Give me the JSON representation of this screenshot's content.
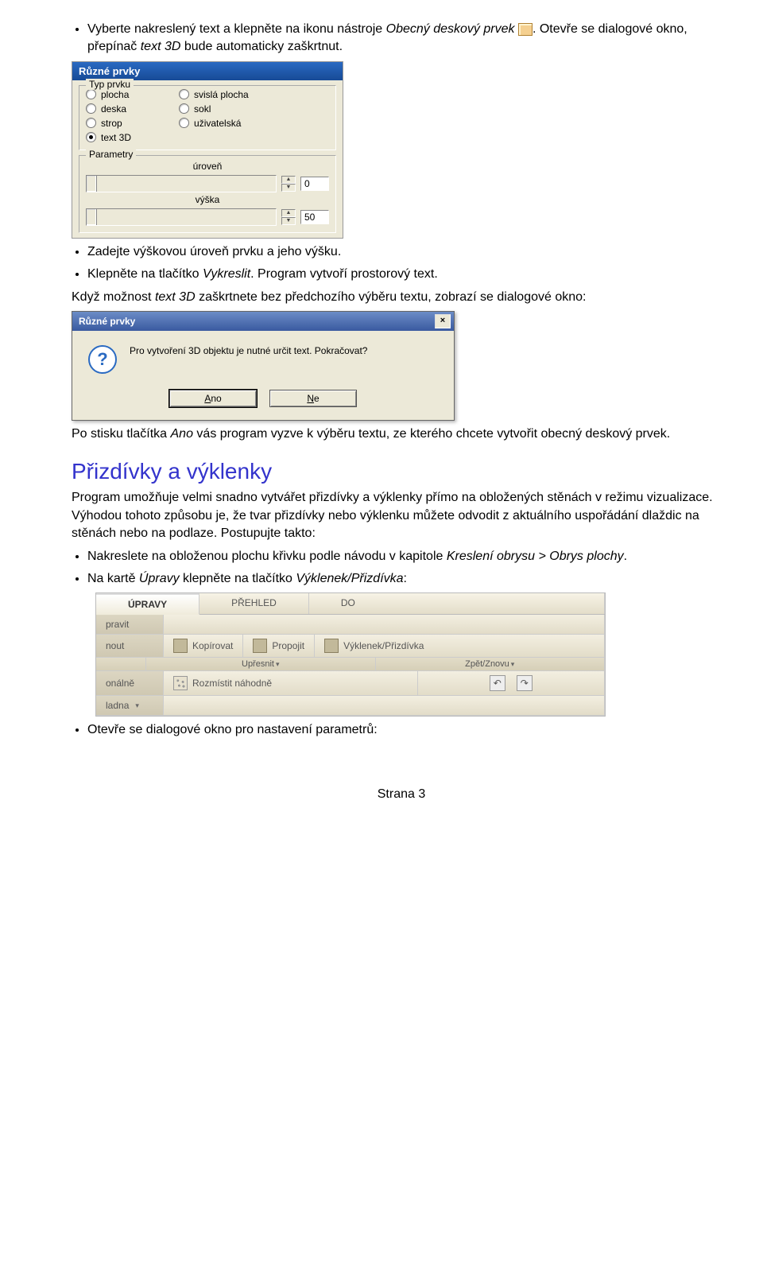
{
  "intro": {
    "li1_a": "Vyberte nakreslený text a klepněte na ikonu nástroje ",
    "li1_tool": "Obecný deskový prvek",
    "li1_b": ". Otevře se dialogové okno, přepínač ",
    "li1_switch": "text 3D",
    "li1_c": " bude automaticky zaškrtnut."
  },
  "dlg1": {
    "title": "Různé prvky",
    "group_type": "Typ prvku",
    "radios_left": [
      "plocha",
      "deska",
      "strop",
      "text 3D"
    ],
    "radios_right": [
      "svislá plocha",
      "sokl",
      "uživatelská"
    ],
    "selected": "text 3D",
    "group_params": "Parametry",
    "lbl_level": "úroveň",
    "val_level": "0",
    "lbl_height": "výška",
    "val_height": "50"
  },
  "after_dlg1": {
    "li2": "Zadejte výškovou úroveň prvku a jeho výšku.",
    "li3_a": "Klepněte na tlačítko ",
    "li3_btn": "Vykreslit",
    "li3_b": ". Program vytvoří prostorový text."
  },
  "cond": {
    "a": "Když možnost ",
    "sw": "text 3D",
    "b": " zaškrtnete bez předchozího výběru textu, zobrazí se dialogové okno:"
  },
  "msg": {
    "title": "Různé prvky",
    "text": "Pro vytvoření 3D objektu je nutné určit text. Pokračovat?",
    "yes_u": "A",
    "yes_r": "no",
    "no_u": "N",
    "no_r": "e"
  },
  "after_msg": {
    "a": "Po stisku tlačítka ",
    "btn": "Ano",
    "b": " vás program vyzve k výběru textu, ze kterého chcete vytvořit obecný deskový prvek."
  },
  "section": {
    "heading": "Přizdívky a výklenky",
    "p1": "Program umožňuje velmi snadno vytvářet přizdívky a výklenky přímo na obložených stěnách v režimu vizualizace. Výhodou tohoto způsobu je, že tvar přizdívky nebo výklenku můžete odvodit z aktuálního uspořádání dlaždic na stěnách nebo na podlaze. Postupujte takto:",
    "li1_a": "Nakreslete na obloženou plochu křivku podle návodu v kapitole ",
    "li1_ref": "Kreslení obrysu > Obrys plochy",
    "li1_b": ".",
    "li2_a": "Na kartě ",
    "li2_tab": "Úpravy",
    "li2_b": " klepněte na tlačítko ",
    "li2_btn": "Výklenek/Přizdívka",
    "li2_c": ":"
  },
  "ribbon": {
    "tabs": [
      "ÚPRAVY",
      "PŘEHLED",
      "DO"
    ],
    "row0": "pravit",
    "r1c1": "nout",
    "r1c2": "Kopírovat",
    "r1c3": "Propojit",
    "r1c4": "Výklenek/Přizdívka",
    "g1": "Upřesnit",
    "g2": "Zpět/Znovu",
    "r3c1": "onálně",
    "r3c2": "Rozmístit náhodně",
    "r4c1": "ladna"
  },
  "final_li": "Otevře se dialogové okno pro nastavení parametrů:",
  "page": "Strana 3"
}
